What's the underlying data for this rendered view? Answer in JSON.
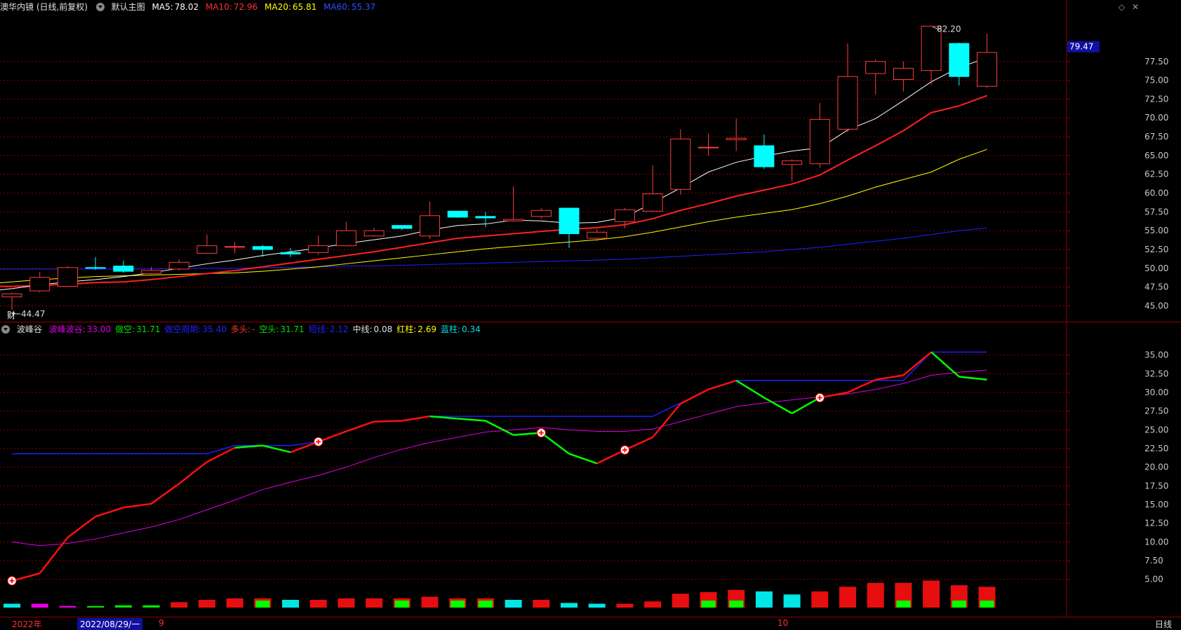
{
  "main_header": {
    "title": "澳华内镜 (日线,前复权)",
    "template": "默认主图",
    "ma5_label": "MA5:",
    "ma5_value": "78.02",
    "ma10_label": "MA10:",
    "ma10_value": "72.96",
    "ma20_label": "MA20:",
    "ma20_value": "65.81",
    "ma60_label": "MA60:",
    "ma60_value": "55.37"
  },
  "indicator_header": {
    "title": "波峰谷",
    "items": [
      {
        "label": "波峰波谷:",
        "value": "33.00",
        "color": "#e000e0"
      },
      {
        "label": "做空:",
        "value": "31.71",
        "color": "#00e000"
      },
      {
        "label": "做空周期:",
        "value": "35.40",
        "color": "#2020ff"
      },
      {
        "label": "多头:",
        "value": "-",
        "color": "#ff3030"
      },
      {
        "label": "空头:",
        "value": "31.71",
        "color": "#00e000"
      },
      {
        "label": "短线:",
        "value": "2.12",
        "color": "#2020ff"
      },
      {
        "label": "中线:",
        "value": "0.08",
        "color": "#e0e0e0"
      },
      {
        "label": "红柱:",
        "value": "2.69",
        "color": "#ffff00"
      },
      {
        "label": "蓝柱:",
        "value": "0.34",
        "color": "#00e0e0"
      }
    ]
  },
  "price_tag": "79.47",
  "high_annotation": "82.20",
  "low_annotation": "44.47",
  "cai_marker": "财",
  "bottom": {
    "year": "2022年",
    "cursor_date": "2022/08/29/一",
    "month9": "9",
    "month10": "10",
    "period": "日线"
  },
  "colors": {
    "up": "#ff3c3c",
    "down": "#00ffff",
    "ma5": "#ffffff",
    "ma10": "#ff2020",
    "ma20": "#ffff00",
    "ma60": "#2020ff",
    "grid": "#8b0000"
  },
  "chart_data": [
    {
      "type": "candlestick",
      "title": "澳华内镜 (日线,前复权)",
      "ylim": [
        43,
        84
      ],
      "yticks": [
        45.0,
        47.5,
        50.0,
        52.5,
        55.0,
        57.5,
        60.0,
        62.5,
        65.0,
        67.5,
        70.0,
        72.5,
        75.0,
        77.5
      ],
      "candles": [
        {
          "o": 46.2,
          "c": 46.6,
          "h": 46.8,
          "l": 44.5
        },
        {
          "o": 47.0,
          "c": 48.8,
          "h": 49.5,
          "l": 46.8
        },
        {
          "o": 47.6,
          "c": 50.1,
          "h": 50.3,
          "l": 47.5
        },
        {
          "o": 50.1,
          "c": 50.0,
          "h": 51.5,
          "l": 49.8
        },
        {
          "o": 50.3,
          "c": 49.6,
          "h": 51.0,
          "l": 49.4
        },
        {
          "o": 49.3,
          "c": 49.7,
          "h": 50.2,
          "l": 49.0
        },
        {
          "o": 49.9,
          "c": 50.8,
          "h": 51.2,
          "l": 49.7
        },
        {
          "o": 52.0,
          "c": 53.0,
          "h": 54.5,
          "l": 51.9
        },
        {
          "o": 52.8,
          "c": 52.9,
          "h": 53.5,
          "l": 52.0
        },
        {
          "o": 52.9,
          "c": 52.5,
          "h": 53.1,
          "l": 51.5
        },
        {
          "o": 52.1,
          "c": 51.9,
          "h": 52.7,
          "l": 51.5
        },
        {
          "o": 52.1,
          "c": 53.0,
          "h": 54.4,
          "l": 51.8
        },
        {
          "o": 53.0,
          "c": 55.0,
          "h": 56.2,
          "l": 52.9
        },
        {
          "o": 54.3,
          "c": 55.0,
          "h": 55.4,
          "l": 54.2
        },
        {
          "o": 55.7,
          "c": 55.3,
          "h": 55.7,
          "l": 55.1
        },
        {
          "o": 54.3,
          "c": 57.0,
          "h": 58.9,
          "l": 53.9
        },
        {
          "o": 57.6,
          "c": 56.8,
          "h": 57.6,
          "l": 56.7
        },
        {
          "o": 56.9,
          "c": 56.7,
          "h": 57.5,
          "l": 55.5
        },
        {
          "o": 56.3,
          "c": 56.5,
          "h": 60.9,
          "l": 56.2
        },
        {
          "o": 56.9,
          "c": 57.7,
          "h": 58.0,
          "l": 56.6
        },
        {
          "o": 58.0,
          "c": 54.6,
          "h": 58.0,
          "l": 52.7
        },
        {
          "o": 54.0,
          "c": 54.8,
          "h": 55.2,
          "l": 53.6
        },
        {
          "o": 56.2,
          "c": 57.8,
          "h": 58.0,
          "l": 55.3
        },
        {
          "o": 57.6,
          "c": 59.9,
          "h": 63.7,
          "l": 57.5
        },
        {
          "o": 60.5,
          "c": 67.2,
          "h": 68.5,
          "l": 59.8
        },
        {
          "o": 66.1,
          "c": 66.1,
          "h": 67.9,
          "l": 65.0
        },
        {
          "o": 67.1,
          "c": 67.3,
          "h": 69.9,
          "l": 65.6
        },
        {
          "o": 66.3,
          "c": 63.5,
          "h": 67.8,
          "l": 63.2
        },
        {
          "o": 63.8,
          "c": 64.3,
          "h": 64.5,
          "l": 61.6
        },
        {
          "o": 63.9,
          "c": 69.8,
          "h": 72.0,
          "l": 63.4
        },
        {
          "o": 68.5,
          "c": 75.5,
          "h": 79.9,
          "l": 68.1
        },
        {
          "o": 75.9,
          "c": 77.5,
          "h": 77.8,
          "l": 73.1
        },
        {
          "o": 75.1,
          "c": 76.6,
          "h": 77.5,
          "l": 73.5
        },
        {
          "o": 76.3,
          "c": 82.2,
          "h": 82.2,
          "l": 74.4
        },
        {
          "o": 79.9,
          "c": 75.5,
          "h": 80.0,
          "l": 74.3
        },
        {
          "o": 74.2,
          "c": 78.7,
          "h": 81.2,
          "l": 74.0
        }
      ],
      "ma5": [
        46.9,
        47.3,
        47.8,
        48.2,
        48.5,
        48.9,
        49.4,
        50.0,
        50.6,
        51.1,
        51.7,
        52.2,
        52.7,
        53.3,
        53.8,
        54.3,
        55.1,
        55.7,
        55.9,
        56.4,
        56.3,
        56.0,
        56.1,
        56.8,
        58.7,
        60.7,
        62.8,
        64.1,
        64.9,
        65.6,
        66.0,
        68.4,
        69.9,
        72.3,
        74.8,
        76.7,
        78.0
      ],
      "ma10": [
        47.6,
        47.6,
        47.7,
        47.9,
        48.1,
        48.2,
        48.5,
        48.9,
        49.3,
        49.7,
        50.2,
        50.7,
        51.2,
        51.7,
        52.2,
        52.8,
        53.4,
        54.0,
        54.3,
        54.6,
        54.9,
        55.2,
        55.4,
        55.8,
        56.6,
        57.7,
        58.6,
        59.6,
        60.4,
        61.2,
        62.4,
        64.4,
        66.3,
        68.3,
        70.7,
        71.6,
        72.96
      ],
      "ma20": [
        47.9,
        48.2,
        48.5,
        48.7,
        48.9,
        49.0,
        49.1,
        49.2,
        49.3,
        49.4,
        49.6,
        49.9,
        50.2,
        50.6,
        51.0,
        51.4,
        51.8,
        52.2,
        52.6,
        52.9,
        53.2,
        53.5,
        53.8,
        54.2,
        54.8,
        55.5,
        56.2,
        56.8,
        57.3,
        57.8,
        58.6,
        59.6,
        60.8,
        61.8,
        62.8,
        64.5,
        65.81
      ],
      "ma60": [
        49.9,
        49.9,
        49.9,
        49.9,
        49.9,
        49.9,
        49.9,
        50.0,
        50.0,
        50.0,
        50.1,
        50.1,
        50.2,
        50.3,
        50.3,
        50.4,
        50.5,
        50.6,
        50.7,
        50.8,
        50.9,
        51.0,
        51.1,
        51.2,
        51.4,
        51.6,
        51.8,
        52.0,
        52.2,
        52.5,
        52.8,
        53.2,
        53.6,
        54.0,
        54.5,
        55.0,
        55.37
      ]
    },
    {
      "type": "line",
      "title": "波峰谷",
      "ylim": [
        0,
        37.5
      ],
      "yticks": [
        5.0,
        7.5,
        10.0,
        12.5,
        15.0,
        17.5,
        20.0,
        22.5,
        25.0,
        27.5,
        30.0,
        32.5,
        35.0
      ],
      "main_line": [
        4.8,
        5.8,
        10.6,
        13.4,
        14.6,
        15.1,
        17.8,
        20.7,
        22.6,
        22.9,
        22.0,
        23.4,
        24.8,
        26.1,
        26.2,
        26.8,
        26.5,
        26.2,
        24.3,
        24.6,
        21.8,
        20.5,
        22.3,
        24.0,
        28.5,
        30.4,
        31.6,
        29.3,
        27.2,
        29.3,
        30.0,
        31.7,
        32.3,
        35.4,
        32.1,
        31.71
      ],
      "main_line_trend": [
        "u",
        "u",
        "u",
        "u",
        "u",
        "u",
        "u",
        "u",
        "u",
        "d",
        "d",
        "u",
        "u",
        "u",
        "u",
        "u",
        "d",
        "d",
        "d",
        "d",
        "d",
        "d",
        "u",
        "u",
        "u",
        "u",
        "u",
        "d",
        "d",
        "d",
        "u",
        "u",
        "u",
        "u",
        "d",
        "d"
      ],
      "wave_line": [
        10.0,
        9.5,
        9.8,
        10.4,
        11.2,
        12.0,
        13.0,
        14.3,
        15.6,
        17.0,
        18.0,
        18.9,
        20.0,
        21.3,
        22.4,
        23.3,
        24.0,
        24.7,
        25.0,
        25.3,
        25.0,
        24.8,
        24.8,
        25.1,
        26.1,
        27.1,
        28.1,
        28.6,
        29.0,
        29.4,
        29.8,
        30.4,
        31.2,
        32.3,
        32.7,
        33.0
      ],
      "cycle_line": [
        21.8,
        21.8,
        21.8,
        21.8,
        21.8,
        21.8,
        21.8,
        21.8,
        22.9,
        22.9,
        22.9,
        23.4,
        null,
        null,
        null,
        26.8,
        26.8,
        26.8,
        26.8,
        26.8,
        26.8,
        26.8,
        26.8,
        26.8,
        28.6,
        null,
        31.6,
        31.6,
        31.6,
        31.6,
        31.6,
        31.6,
        31.6,
        35.4,
        35.4,
        35.4
      ],
      "signals_at": [
        0,
        11,
        19,
        22,
        29
      ],
      "bars": [
        {
          "v": 0.5,
          "c": "d"
        },
        {
          "v": 0.5,
          "c": "m"
        },
        {
          "v": 0.2,
          "c": "m"
        },
        {
          "v": 0.2,
          "c": "g"
        },
        {
          "v": 0.3,
          "c": "g"
        },
        {
          "v": 0.3,
          "c": "g"
        },
        {
          "v": 0.7,
          "c": "r"
        },
        {
          "v": 1.0,
          "c": "r"
        },
        {
          "v": 1.2,
          "c": "r"
        },
        {
          "v": 1.2,
          "c": "dg"
        },
        {
          "v": 1.0,
          "c": "d"
        },
        {
          "v": 1.0,
          "c": "r"
        },
        {
          "v": 1.2,
          "c": "r"
        },
        {
          "v": 1.2,
          "c": "r"
        },
        {
          "v": 1.2,
          "c": "dg"
        },
        {
          "v": 1.4,
          "c": "r"
        },
        {
          "v": 1.2,
          "c": "dg"
        },
        {
          "v": 1.2,
          "c": "dg"
        },
        {
          "v": 1.0,
          "c": "d"
        },
        {
          "v": 1.0,
          "c": "r"
        },
        {
          "v": 0.6,
          "c": "d"
        },
        {
          "v": 0.5,
          "c": "d"
        },
        {
          "v": 0.5,
          "c": "r"
        },
        {
          "v": 0.8,
          "c": "r"
        },
        {
          "v": 1.8,
          "c": "r"
        },
        {
          "v": 2.0,
          "c": "rg"
        },
        {
          "v": 2.3,
          "c": "rg"
        },
        {
          "v": 2.1,
          "c": "d"
        },
        {
          "v": 1.7,
          "c": "d"
        },
        {
          "v": 2.1,
          "c": "r"
        },
        {
          "v": 2.7,
          "c": "r"
        },
        {
          "v": 3.2,
          "c": "r"
        },
        {
          "v": 3.2,
          "c": "rg"
        },
        {
          "v": 3.5,
          "c": "r"
        },
        {
          "v": 2.9,
          "c": "dg"
        },
        {
          "v": 2.69,
          "c": "dg"
        }
      ]
    }
  ]
}
